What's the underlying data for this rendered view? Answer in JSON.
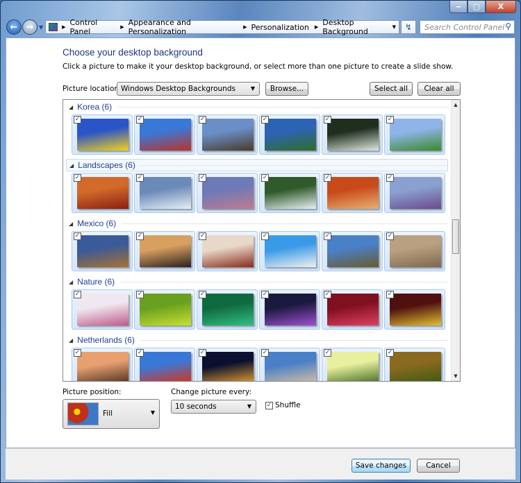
{
  "window": {
    "minimize": "‒",
    "maximize": "▢",
    "close": "X"
  },
  "address": {
    "crumbs": [
      "Control Panel",
      "Appearance and Personalization",
      "Personalization",
      "Desktop Background"
    ],
    "search_placeholder": "Search Control Panel"
  },
  "main": {
    "title": "Choose your desktop background",
    "description": "Click a picture to make it your desktop background, or select more than one picture to create a slide show.",
    "location_label": "Picture location:",
    "location_value": "Windows Desktop Backgrounds",
    "browse": "Browse...",
    "select_all": "Select all",
    "clear_all": "Clear all",
    "groups": [
      {
        "label": "Korea (6)",
        "selected": false,
        "thumbs": [
          [
            "#2a55c8",
            "#f2d21a"
          ],
          [
            "#3a78d8",
            "#b8342a"
          ],
          [
            "#6a8fc8",
            "#4a3a2a"
          ],
          [
            "#2d63b5",
            "#2f6e2a"
          ],
          [
            "#1f2e1e",
            "#dfe8e0"
          ],
          [
            "#8fb4e8",
            "#3a8a2a"
          ]
        ]
      },
      {
        "label": "Landscapes (6)",
        "selected": true,
        "thumbs": [
          [
            "#d26a2a",
            "#8a2010"
          ],
          [
            "#6a8ab8",
            "#e8eef5"
          ],
          [
            "#6d7ab8",
            "#c07a90"
          ],
          [
            "#2f5a2a",
            "#e8f0f0"
          ],
          [
            "#c84a1a",
            "#e8b070"
          ],
          [
            "#8aa0d0",
            "#6a4a8a"
          ]
        ]
      },
      {
        "label": "Mexico (6)",
        "selected": false,
        "thumbs": [
          [
            "#3a5a9a",
            "#a87030"
          ],
          [
            "#d8a060",
            "#2a2020"
          ],
          [
            "#e8d8c8",
            "#8a2a1a"
          ],
          [
            "#3a9ae8",
            "#f0f0f0"
          ],
          [
            "#4a80c8",
            "#6a5a30"
          ],
          [
            "#b8a080",
            "#806850"
          ]
        ]
      },
      {
        "label": "Nature (6)",
        "selected": false,
        "thumbs": [
          [
            "#f0e8f0",
            "#c05a8a"
          ],
          [
            "#6aa020",
            "#c8e030"
          ],
          [
            "#106a40",
            "#30c080"
          ],
          [
            "#1a1a40",
            "#a050d0"
          ],
          [
            "#801020",
            "#e04060"
          ],
          [
            "#501010",
            "#e0c030"
          ]
        ]
      },
      {
        "label": "Netherlands (6)",
        "selected": false,
        "thumbs": [
          [
            "#e8a070",
            "#4a3020"
          ],
          [
            "#3a78d8",
            "#e03010"
          ],
          [
            "#0a1030",
            "#e8a030"
          ],
          [
            "#4a80c8",
            "#d8c0a0"
          ],
          [
            "#e8f0a0",
            "#406a20"
          ],
          [
            "#8a6a20",
            "#3a5a10"
          ]
        ]
      }
    ],
    "position_label": "Picture position:",
    "position_value": "Fill",
    "interval_label": "Change picture every:",
    "interval_value": "10 seconds",
    "shuffle_label": "Shuffle",
    "shuffle_checked": true
  },
  "footer": {
    "save": "Save changes",
    "cancel": "Cancel"
  }
}
